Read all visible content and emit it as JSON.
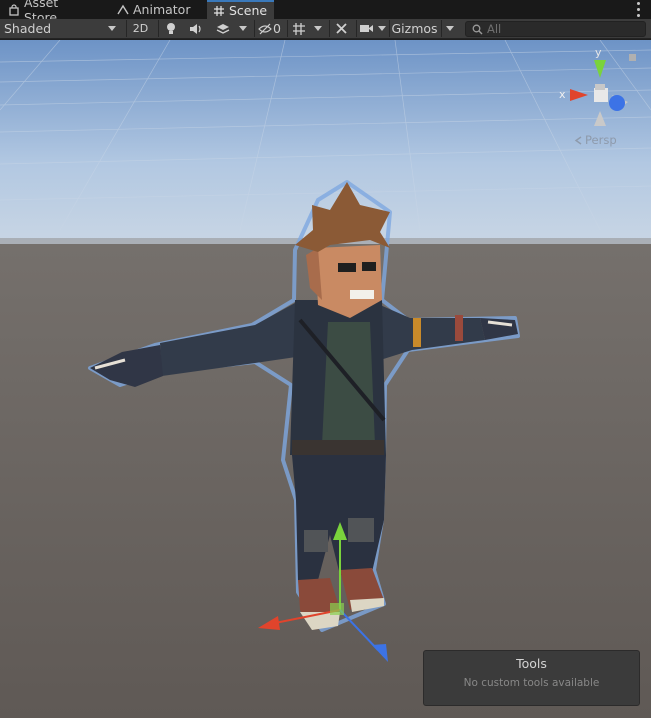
{
  "tabs": [
    {
      "label": "Asset Store",
      "icon": "shopping-bag-icon",
      "active": false
    },
    {
      "label": "Animator",
      "icon": "animator-icon",
      "active": false
    },
    {
      "label": "Scene",
      "icon": "grid-icon",
      "active": true
    }
  ],
  "toolbar": {
    "draw_mode": "Shaded",
    "mode_2d": "2D",
    "hidden_count": "0",
    "gizmos": "Gizmos",
    "search_placeholder": "All"
  },
  "scene": {
    "projection_label": "Persp",
    "axis_x": "x",
    "axis_y": "y"
  },
  "tools_panel": {
    "title": "Tools",
    "message": "No custom tools available"
  },
  "colors": {
    "accent": "#3a79bb",
    "axis_x": "#e0442c",
    "axis_y": "#7ad33c",
    "axis_z": "#3c73e6"
  }
}
